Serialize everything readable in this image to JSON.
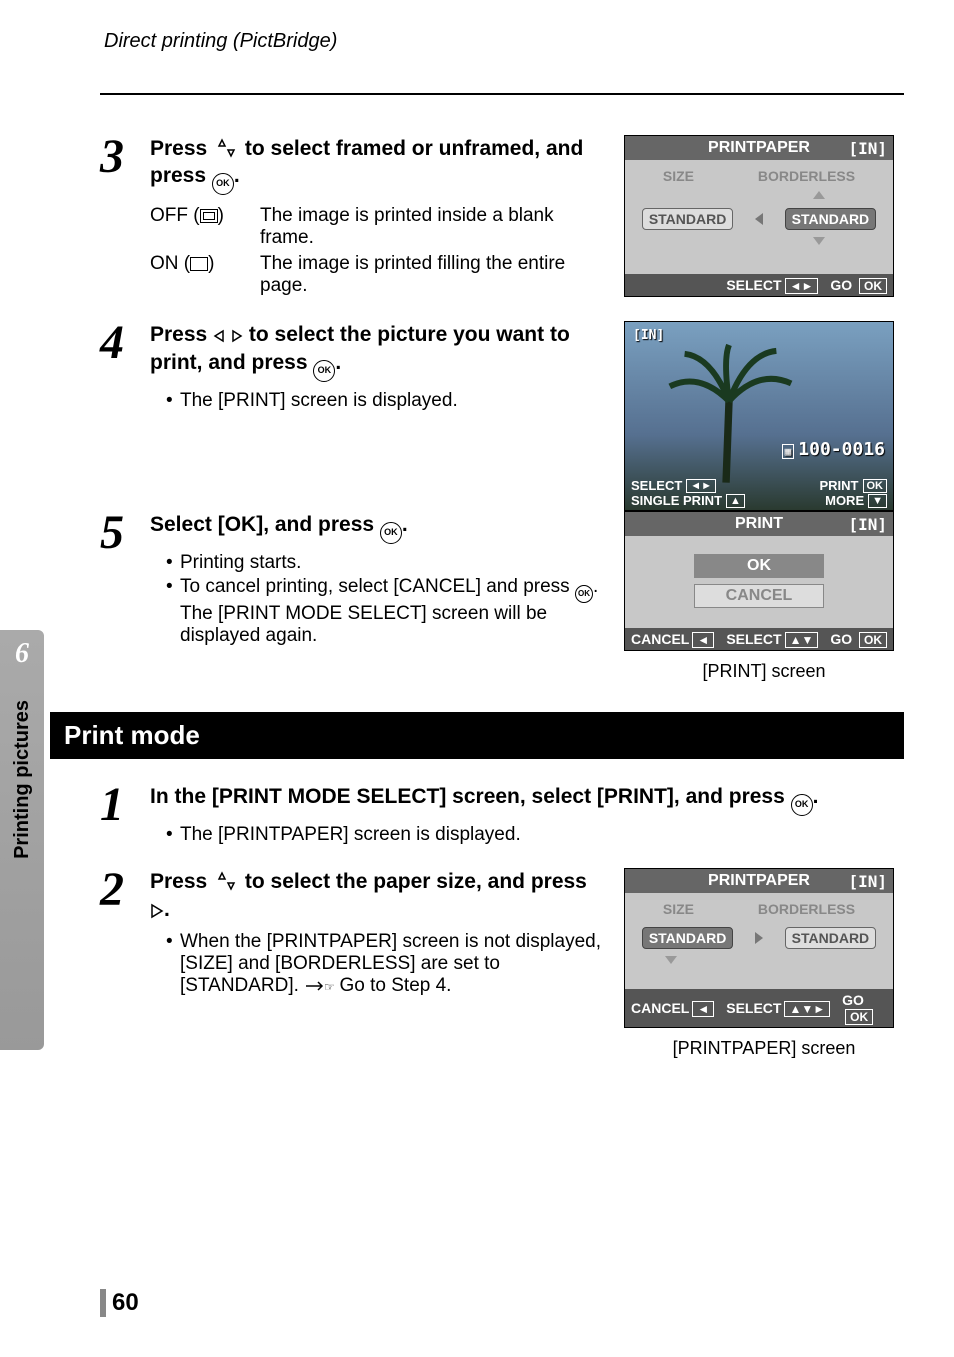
{
  "header": {
    "title": "Direct printing (PictBridge)"
  },
  "sideTab": {
    "chapter": "6",
    "label": "Printing pictures"
  },
  "pageNumber": "60",
  "steps": {
    "s3": {
      "num": "3",
      "head_a": "Press ",
      "head_b": " to select framed or unframed, and press ",
      "head_c": ".",
      "defs": [
        {
          "key": "OFF (",
          "keyEnd": ")",
          "val": "The image is printed inside a blank frame."
        },
        {
          "key": "ON (",
          "keyEnd": ")",
          "val": "The image is printed filling the entire page."
        }
      ]
    },
    "s4": {
      "num": "4",
      "head_a": "Press ",
      "head_b": " to select the picture you want to print, and press ",
      "head_c": ".",
      "bullet": "The [PRINT] screen is displayed."
    },
    "s5": {
      "num": "5",
      "head_a": "Select [OK], and press ",
      "head_b": ".",
      "bullets": [
        "Printing starts.",
        "To cancel printing, select [CANCEL] and press "
      ],
      "bullet2b": ". The [PRINT MODE SELECT] screen will be displayed again."
    }
  },
  "section2": {
    "title": "Print mode"
  },
  "steps2": {
    "s1": {
      "num": "1",
      "head_a": "In the [PRINT MODE SELECT] screen, select [PRINT], and press ",
      "head_b": ".",
      "bullet": "The [PRINTPAPER] screen is displayed."
    },
    "s2": {
      "num": "2",
      "head_a": "Press ",
      "head_b": " to select the paper size, and press ",
      "head_c": ".",
      "bullet_a": "When the [PRINTPAPER] screen is not displayed, [SIZE] and [BORDERLESS] are set to [STANDARD].  ",
      "bullet_b": " Go to Step 4."
    }
  },
  "screens": {
    "paper1": {
      "title": "PRINTPAPER",
      "tag": "[IN]",
      "col1": "SIZE",
      "col2": "BORDERLESS",
      "btn1": "STANDARD",
      "btn2": "STANDARD",
      "foot_select": "SELECT",
      "foot_go": "GO",
      "foot_ok": "OK"
    },
    "photo": {
      "tag": "[IN]",
      "file": "100-0016",
      "select": "SELECT",
      "print": "PRINT",
      "ok": "OK",
      "single": "SINGLE PRINT",
      "more": "MORE"
    },
    "print": {
      "title": "PRINT",
      "tag": "[IN]",
      "ok": "OK",
      "cancel": "CANCEL",
      "foot_cancel": "CANCEL",
      "foot_select": "SELECT",
      "foot_go": "GO",
      "foot_ok": "OK",
      "caption": "[PRINT] screen"
    },
    "paper2": {
      "title": "PRINTPAPER",
      "tag": "[IN]",
      "col1": "SIZE",
      "col2": "BORDERLESS",
      "btn1": "STANDARD",
      "btn2": "STANDARD",
      "foot_cancel": "CANCEL",
      "foot_select": "SELECT",
      "foot_go": "GO",
      "foot_ok": "OK",
      "caption": "[PRINTPAPER] screen"
    }
  }
}
